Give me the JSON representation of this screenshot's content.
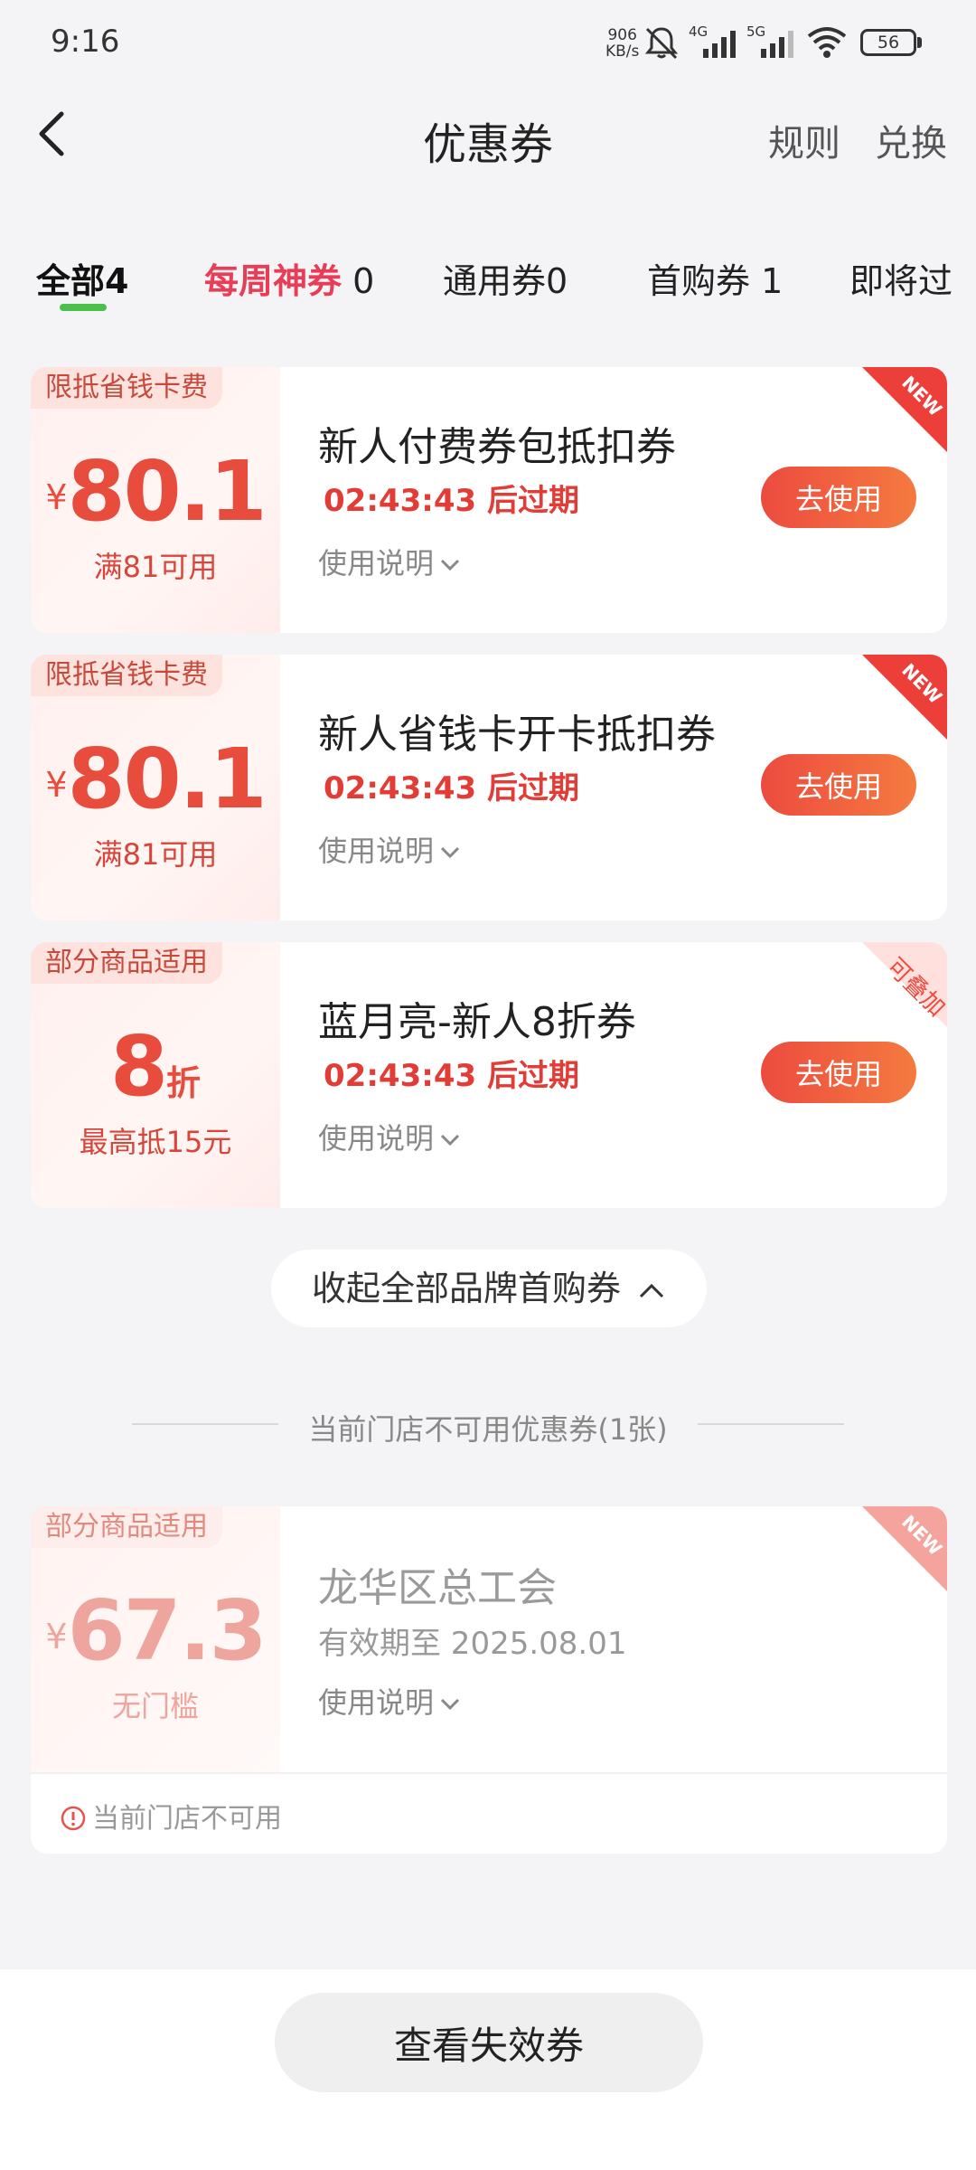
{
  "status_bar": {
    "time": "9:16",
    "net_speed_value": "906",
    "net_speed_unit": "KB/s",
    "signal1": "4G",
    "signal2": "5G",
    "battery": "56"
  },
  "header": {
    "title": "优惠券",
    "rules": "规则",
    "redeem": "兑换"
  },
  "tabs": [
    {
      "label": "全部",
      "count": "4"
    },
    {
      "label": "每周神券",
      "count": "0"
    },
    {
      "label": "通用券",
      "count": "0"
    },
    {
      "label": "首购券",
      "count": "1"
    },
    {
      "label": "即将过",
      "count": ""
    }
  ],
  "coupons": [
    {
      "tag": "限抵省钱卡费",
      "currency": "¥",
      "amount": "80.1",
      "condition": "满81可用",
      "name": "新人付费券包抵扣券",
      "expiry": "02:43:43 后过期",
      "desc": "使用说明",
      "button": "去使用",
      "corner": "NEW"
    },
    {
      "tag": "限抵省钱卡费",
      "currency": "¥",
      "amount": "80.1",
      "condition": "满81可用",
      "name": "新人省钱卡开卡抵扣券",
      "expiry": "02:43:43 后过期",
      "desc": "使用说明",
      "button": "去使用",
      "corner": "NEW"
    },
    {
      "tag": "部分商品适用",
      "amount": "8",
      "unit": "折",
      "condition": "最高抵15元",
      "name": "蓝月亮-新人8折券",
      "expiry": "02:43:43 后过期",
      "desc": "使用说明",
      "button": "去使用",
      "corner": "可叠加"
    }
  ],
  "collapse_label": "收起全部品牌首购券",
  "unavailable_divider": "当前门店不可用优惠券(1张)",
  "unavailable_coupon": {
    "tag": "部分商品适用",
    "currency": "¥",
    "amount": "67.3",
    "condition": "无门槛",
    "name": "龙华区总工会",
    "validity": "有效期至 2025.08.01",
    "desc": "使用说明",
    "corner": "NEW",
    "warning": "当前门店不可用"
  },
  "bottom_button": "查看失效券"
}
